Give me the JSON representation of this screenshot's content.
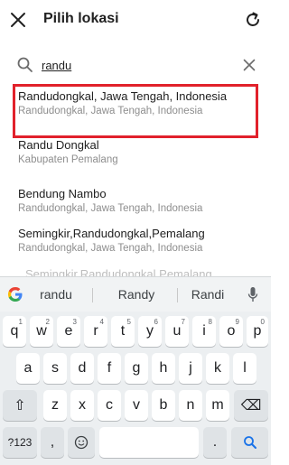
{
  "header": {
    "title": "Pilih lokasi",
    "close_icon": "close-icon",
    "refresh_icon": "refresh-icon"
  },
  "search": {
    "value": "randu",
    "icon": "search-icon",
    "clear_icon": "clear-icon"
  },
  "results": [
    {
      "name": "Randudongkal, Jawa Tengah, Indonesia",
      "sub": "Randudongkal, Jawa Tengah, Indonesia",
      "selected": true
    },
    {
      "name": "Randu Dongkal",
      "sub": "Kabupaten Pemalang",
      "selected": false
    },
    {
      "name": "Bendung Nambo",
      "sub": "Randudongkal, Jawa Tengah, Indonesia",
      "selected": false
    },
    {
      "name": "Semingkir,Randudongkal,Pemalang",
      "sub": "Randudongkal, Jawa Tengah, Indonesia",
      "selected": false
    }
  ],
  "partial_result": "Semingkir,Randudongkal,Pemalang",
  "highlight_color": "#e1212b",
  "keyboard": {
    "suggestions": [
      "randu",
      "Randy",
      "Randi"
    ],
    "row1": [
      {
        "k": "q",
        "s": "1"
      },
      {
        "k": "w",
        "s": "2"
      },
      {
        "k": "e",
        "s": "3"
      },
      {
        "k": "r",
        "s": "4"
      },
      {
        "k": "t",
        "s": "5"
      },
      {
        "k": "y",
        "s": "6"
      },
      {
        "k": "u",
        "s": "7"
      },
      {
        "k": "i",
        "s": "8"
      },
      {
        "k": "o",
        "s": "9"
      },
      {
        "k": "p",
        "s": "0"
      }
    ],
    "row2": [
      "a",
      "s",
      "d",
      "f",
      "g",
      "h",
      "j",
      "k",
      "l"
    ],
    "row3": [
      "z",
      "x",
      "c",
      "v",
      "b",
      "n",
      "m"
    ],
    "symbols_label": "?123",
    "comma": ",",
    "period": ".",
    "shift_glyph": "⇧",
    "backspace_glyph": "⌫"
  }
}
